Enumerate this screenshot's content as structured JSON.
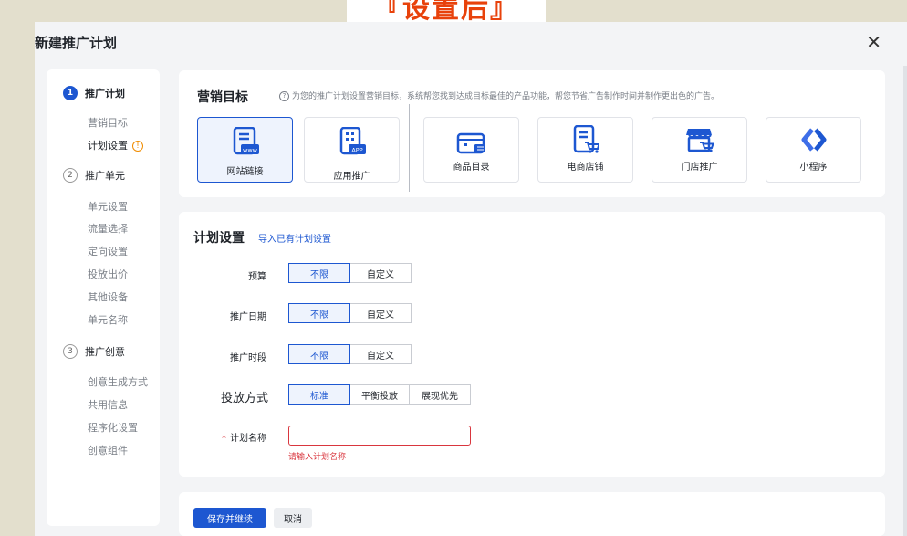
{
  "banner": {
    "text": "『设置后』"
  },
  "dialog": {
    "title": "新建推广计划",
    "close_icon": "close-icon"
  },
  "nav": {
    "steps": [
      {
        "num": "1",
        "label": "推广计划",
        "subs": [
          "营销目标",
          "计划设置"
        ]
      },
      {
        "num": "2",
        "label": "推广单元",
        "subs": [
          "单元设置",
          "流量选择",
          "定向设置",
          "投放出价",
          "其他设备",
          "单元名称"
        ]
      },
      {
        "num": "3",
        "label": "推广创意",
        "subs": [
          "创意生成方式",
          "共用信息",
          "程序化设置",
          "创意组件"
        ]
      }
    ],
    "warn_mark": "!"
  },
  "goal": {
    "title": "营销目标",
    "hint": "为您的推广计划设置营销目标，系统帮您找到达成目标最佳的产品功能，帮您节省广告制作时间并制作更出色的广告。",
    "help_mark": "?",
    "items": [
      {
        "label": "网站链接",
        "icon": "website-link-icon",
        "badge": "www"
      },
      {
        "label": "应用推广",
        "icon": "app-promotion-icon",
        "badge": "APP"
      },
      {
        "label": "商品目录",
        "icon": "product-catalog-icon"
      },
      {
        "label": "电商店铺",
        "icon": "ecommerce-store-icon"
      },
      {
        "label": "门店推广",
        "icon": "store-promotion-icon"
      },
      {
        "label": "小程序",
        "icon": "mini-program-icon"
      }
    ]
  },
  "plan": {
    "title": "计划设置",
    "import_link": "导入已有计划设置",
    "budget": {
      "label": "预算",
      "options": [
        "不限",
        "自定义"
      ]
    },
    "date": {
      "label": "推广日期",
      "options": [
        "不限",
        "自定义"
      ]
    },
    "period": {
      "label": "推广时段",
      "options": [
        "不限",
        "自定义"
      ]
    },
    "delivery": {
      "label": "投放方式",
      "options": [
        "标准",
        "平衡投放",
        "展现优先"
      ]
    },
    "name": {
      "label": "计划名称",
      "required_mark": "*",
      "error": "请输入计划名称",
      "value": ""
    }
  },
  "footer": {
    "save": "保存并继续",
    "cancel": "取消"
  },
  "colors": {
    "accent": "#1d57d1",
    "error": "#d9363e",
    "warning": "#f08c00",
    "banner": "#e8420b"
  }
}
